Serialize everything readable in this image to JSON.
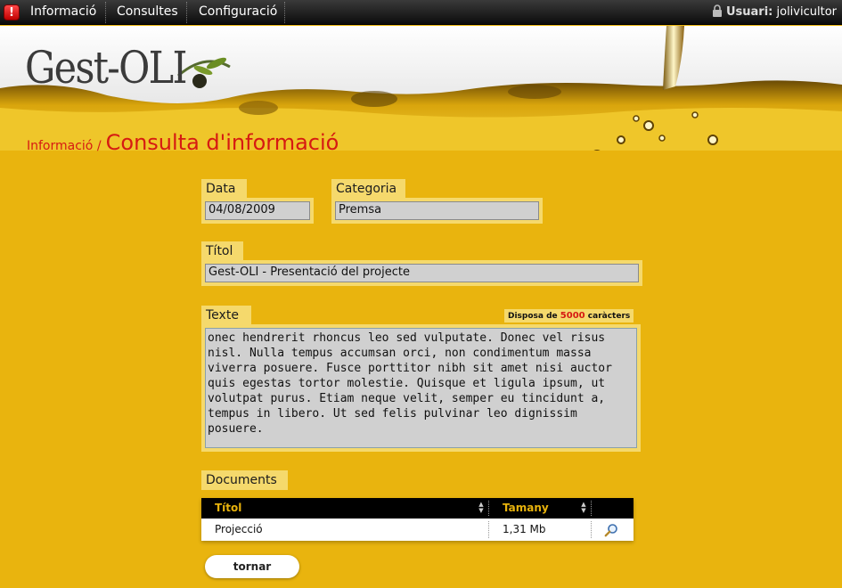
{
  "menu": {
    "items": [
      {
        "label": "Informació"
      },
      {
        "label": "Consultes"
      },
      {
        "label": "Configuració"
      }
    ],
    "user_label": "Usuari:",
    "user_name": "jolivicultor"
  },
  "logo": {
    "text": "Gest-OLI"
  },
  "breadcrumb": {
    "parent": "Informació /",
    "current": "Consulta d'informació"
  },
  "form": {
    "data_label": "Data",
    "data_value": "04/08/2009",
    "categoria_label": "Categoria",
    "categoria_value": "Premsa",
    "titol_label": "Títol",
    "titol_value": "Gest-OLI - Presentació del projecte",
    "texte_label": "Texte",
    "chars_prefix": "Disposa de",
    "chars_count": "5000",
    "chars_suffix": "caràcters",
    "texte_value": "onec hendrerit rhoncus leo sed vulputate. Donec vel risus\nnisl. Nulla tempus accumsan orci, non condimentum massa\nviverra posuere. Fusce porttitor nibh sit amet nisi auctor\nquis egestas tortor molestie. Quisque et ligula ipsum, ut\nvolutpat purus. Etiam neque velit, semper eu tincidunt a,\ntempus in libero. Ut sed felis pulvinar leo dignissim\nposuere."
  },
  "documents": {
    "label": "Documents",
    "columns": [
      "Títol",
      "Tamany"
    ],
    "rows": [
      {
        "titol": "Projecció",
        "tamany": "1,31 Mb"
      }
    ]
  },
  "back_button": "tornar",
  "colors": {
    "accent_red": "#d61a12",
    "oil_yellow": "#e9b40e",
    "header_gold": "#e7b20c"
  }
}
